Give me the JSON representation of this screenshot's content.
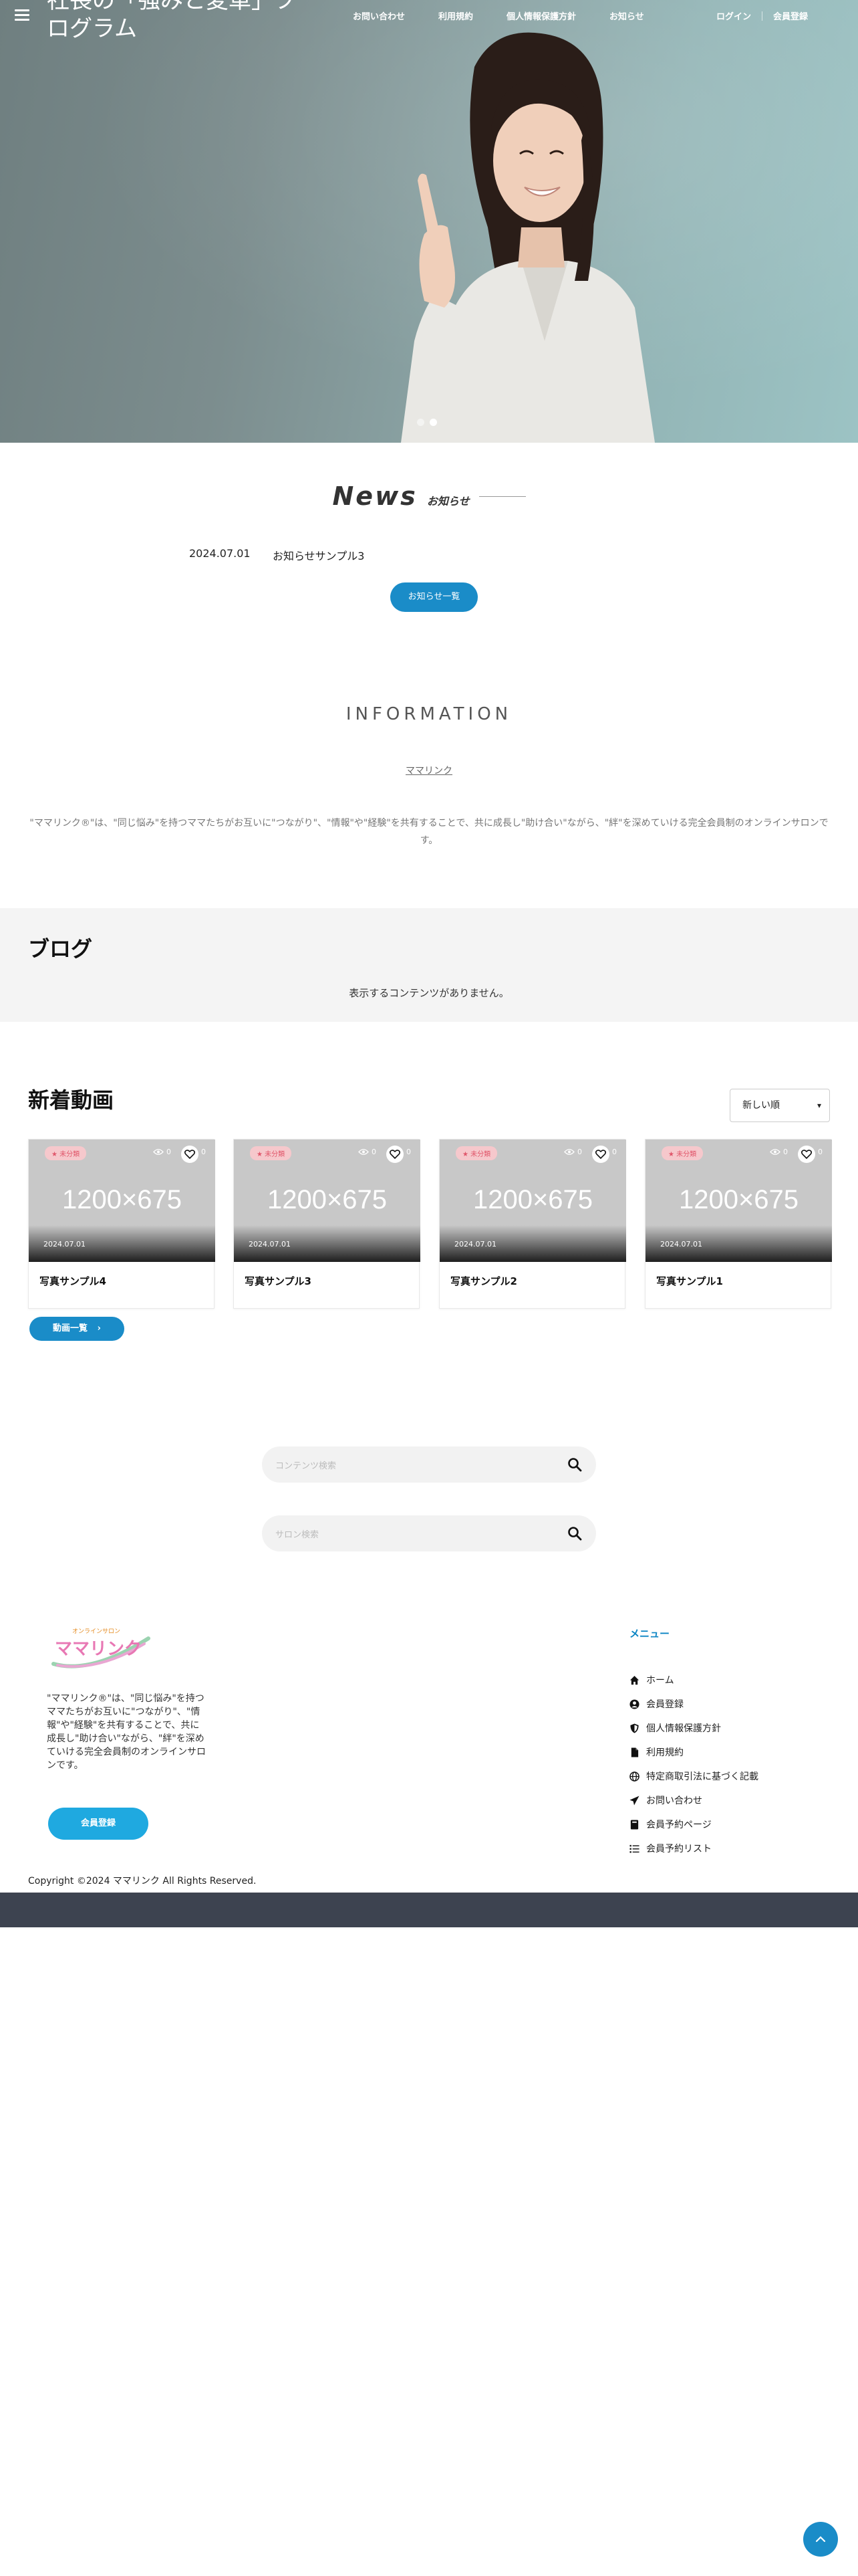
{
  "hero": {
    "title": "社長の「強みと変革」プログラム",
    "nav": [
      "お問い合わせ",
      "利用規約",
      "個人情報保護方針",
      "お知らせ"
    ],
    "login": "ログイン",
    "register": "会員登録"
  },
  "news": {
    "heading": "News",
    "subheading": "お知らせ",
    "items": [
      {
        "date": "2024.07.01",
        "title": "お知らせサンプル3"
      }
    ],
    "button": "お知らせ一覧"
  },
  "information": {
    "title": "INFORMATION",
    "link": "ママリンク",
    "text": "\"ママリンク®\"は、\"同じ悩み\"を持つママたちがお互いに\"つながり\"、\"情報\"や\"経験\"を共有することで、共に成長し\"助け合い\"ながら、\"絆\"を深めていける完全会員制のオンラインサロンです。"
  },
  "blog": {
    "title": "ブログ",
    "empty": "表示するコンテンツがありません。"
  },
  "videos": {
    "title": "新着動画",
    "sort": "新しい順",
    "button": "動画一覧",
    "cards": [
      {
        "name": "写真サンプル4",
        "date": "2024.07.01",
        "badge": "★ 未分類",
        "views": "0",
        "likes": "0",
        "placeholder": "1200×675"
      },
      {
        "name": "写真サンプル3",
        "date": "2024.07.01",
        "badge": "★ 未分類",
        "views": "0",
        "likes": "0",
        "placeholder": "1200×675"
      },
      {
        "name": "写真サンプル2",
        "date": "2024.07.01",
        "badge": "★ 未分類",
        "views": "0",
        "likes": "0",
        "placeholder": "1200×675"
      },
      {
        "name": "写真サンプル1",
        "date": "2024.07.01",
        "badge": "★ 未分類",
        "views": "0",
        "likes": "0",
        "placeholder": "1200×675"
      }
    ]
  },
  "search": {
    "content_placeholder": "コンテンツ検索",
    "salon_placeholder": "サロン検索"
  },
  "footer": {
    "logo_top": "オンラインサロン",
    "logo_main": "ママリンク",
    "description": "\"ママリンク®\"は、\"同じ悩み\"を持つママたちがお互いに\"つながり\"、\"情報\"や\"経験\"を共有することで、共に成長し\"助け合い\"ながら、\"絆\"を深めていける完全会員制のオンラインサロンです。",
    "register_button": "会員登録",
    "menu_title": "メニュー",
    "menu": [
      "ホーム",
      "会員登録",
      "個人情報保護方針",
      "利用規約",
      "特定商取引法に基づく記載",
      "お問い合わせ",
      "会員予約ページ",
      "会員予約リスト"
    ],
    "copyright": "Copyright ©2024 ママリンク All Rights Reserved."
  },
  "colors": {
    "accent": "#1a8cc8",
    "footer_bar": "#3d4350",
    "badge_bg": "#f6c8cc",
    "badge_text": "#e0566a"
  }
}
